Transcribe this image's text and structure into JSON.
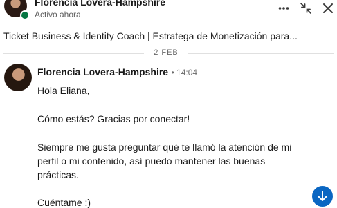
{
  "header": {
    "name": "Florencia Lovera-Hampshire",
    "status": "Activo ahora",
    "more_icon": "ellipsis-icon",
    "collapse_icon": "collapse-arrows-icon",
    "close_icon": "close-icon"
  },
  "profile": {
    "headline": "Ticket Business & Identity Coach | Estratega de Monetización para..."
  },
  "conversation": {
    "date": "2 FEB",
    "message": {
      "sender": "Florencia Lovera-Hampshire",
      "time": "• 14:04",
      "lines": [
        "Hola Eliana,",
        "Cómo estás? Gracias por conectar!",
        "Siempre me gusta preguntar qué te llamó la atención de mi",
        "perfil o mi contenido, así puedo mantener las buenas",
        "prácticas.",
        "Cuéntame :)"
      ]
    },
    "scroll_icon": "arrow-down-icon"
  },
  "colors": {
    "accent": "#0a66c2",
    "online": "#057642",
    "text": "#191919",
    "muted": "#666666"
  }
}
